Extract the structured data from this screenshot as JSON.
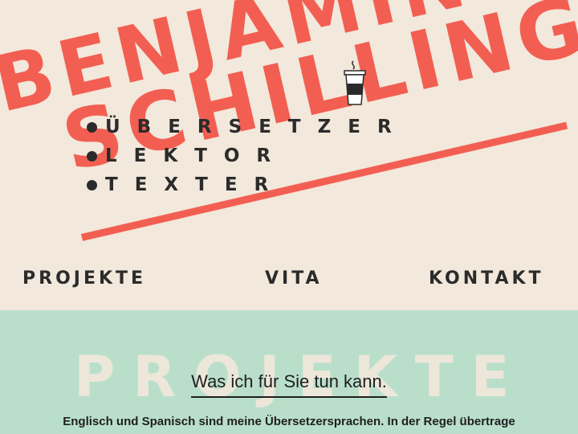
{
  "header": {
    "logo_line1": "BENJAMIN",
    "logo_line2": "SCHILLING",
    "roles": [
      "ÜBERSETZER",
      "LEKTOR",
      "TEXTER"
    ],
    "icon": "coffee-cup-icon",
    "accent_color": "#f25f52"
  },
  "nav": {
    "items": [
      "PROJEKTE",
      "VITA",
      "KONTAKT"
    ]
  },
  "projects": {
    "watermark": "PROJEKTE",
    "subheading": "Was ich für Sie tun kann.",
    "intro": "Englisch und Spanisch sind meine Übersetzersprachen. In der Regel übertrage",
    "background_color": "#b9dfcb"
  }
}
